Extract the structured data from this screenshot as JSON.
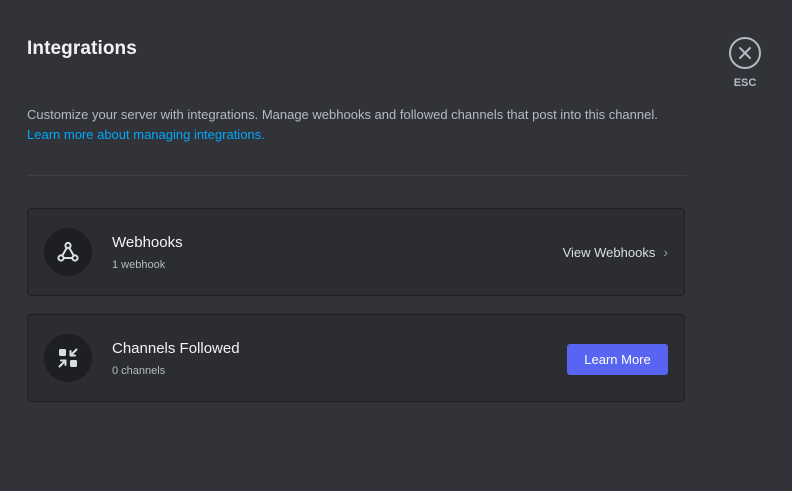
{
  "modal": {
    "title": "Integrations",
    "description": "Customize your server with integrations. Manage webhooks and followed channels that post into this channel.",
    "learn_more_link": "Learn more about managing integrations."
  },
  "close": {
    "esc_label": "ESC",
    "icon": "close-icon"
  },
  "webhooks": {
    "icon": "webhook-icon",
    "title": "Webhooks",
    "subtitle": "1 webhook",
    "action_label": "View Webhooks",
    "chevron": "›"
  },
  "channels_followed": {
    "icon": "channel-follow-icon",
    "title": "Channels Followed",
    "subtitle": "0 channels",
    "button_label": "Learn More"
  },
  "colors": {
    "background": "#313338",
    "card": "#2b2d31",
    "link": "#00a8fc",
    "accent_button": "#5865f2"
  }
}
